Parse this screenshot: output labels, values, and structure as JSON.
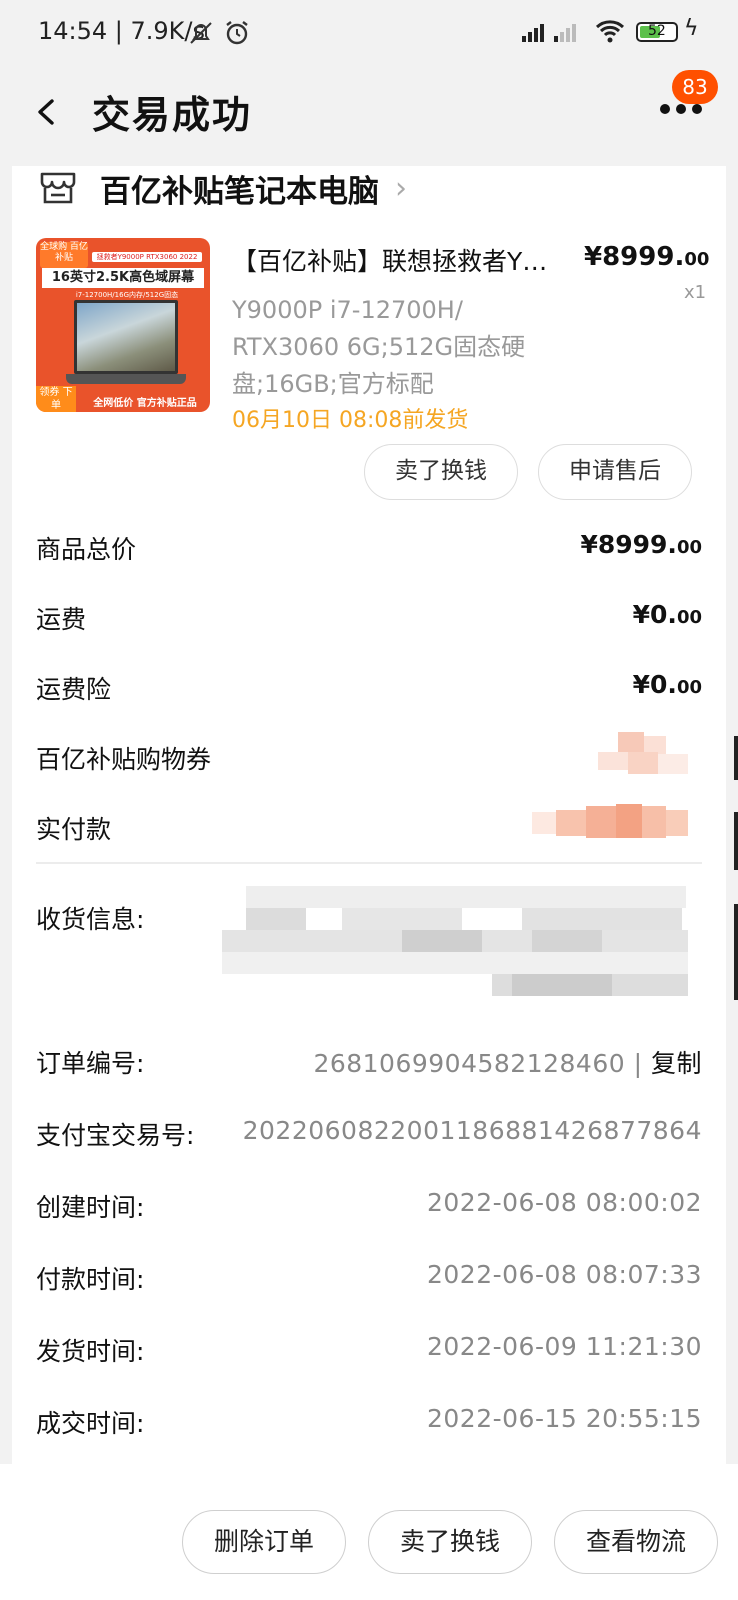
{
  "status_bar": {
    "time": "14:54",
    "net_speed": "7.9K/s",
    "battery": "52"
  },
  "header": {
    "title": "交易成功",
    "back_icon": "back-arrow-icon",
    "more_icon": "more-icon",
    "badge_count": "83"
  },
  "shop": {
    "name": "百亿补贴笔记本电脑",
    "icon": "store-icon"
  },
  "product": {
    "title": "【百亿补贴】联想拯救者Y…",
    "price_main": "¥8999.",
    "price_dec": "00",
    "qty": "x1",
    "spec_lines": [
      "Y9000P i7-12700H/",
      "RTX3060 6G;512G固态硬",
      "盘;16GB;官方标配"
    ],
    "ship_note": "06月10日 08:08前发货",
    "thumb": {
      "corner": "全球购\n百亿补贴",
      "model": "拯救者Y9000P RTX3060 2022",
      "headline": "16英寸2.5K高色域屏幕",
      "config": "i7-12700H/16G内存/512G固态",
      "coupon": "领券\n下单",
      "footer": "全网低价 官方补贴正品"
    },
    "buttons": [
      "卖了换钱",
      "申请售后"
    ]
  },
  "costs": [
    {
      "label": "商品总价",
      "main": "¥8999.",
      "dec": "00"
    },
    {
      "label": "运费",
      "main": "¥0.",
      "dec": "00"
    },
    {
      "label": "运费险",
      "main": "¥0.",
      "dec": "00"
    }
  ],
  "coupon_label": "百亿补贴购物券",
  "paid_label": "实付款",
  "shipping_label": "收货信息:",
  "info": {
    "order_no_label": "订单编号:",
    "order_no": "2681069904582128460",
    "copy_label": "复制",
    "alipay_label": "支付宝交易号:",
    "alipay_no": "2022060822001186881426877864",
    "created_label": "创建时间:",
    "created": "2022-06-08 08:00:02",
    "paid_label": "付款时间:",
    "paid": "2022-06-08 08:07:33",
    "shipped_label": "发货时间:",
    "shipped": "2022-06-09 11:21:30",
    "done_label": "成交时间:",
    "done": "2022-06-15 20:55:15"
  },
  "bottom_buttons": [
    "删除订单",
    "卖了换钱",
    "查看物流"
  ]
}
